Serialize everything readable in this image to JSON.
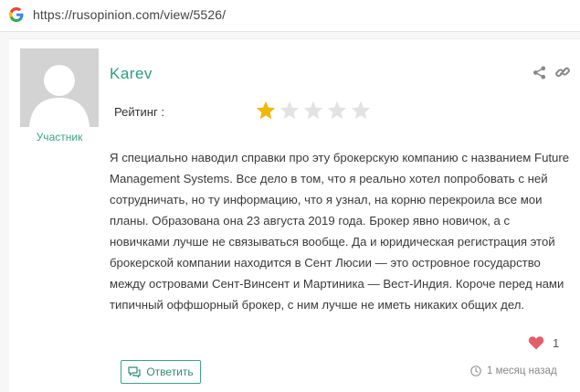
{
  "browser": {
    "url": "https://rusopinion.com/view/5526/",
    "icon": "google-g-icon"
  },
  "review": {
    "author": "Karev",
    "role": "Участник",
    "rating_label": "Рейтинг :",
    "rating": 1,
    "rating_max": 5,
    "star_filled_color": "#f2b705",
    "star_empty_color": "#e3e3e3",
    "text": "Я специально наводил справки про эту брокерскую компанию с названием Future Management Systems. Все дело в том, что я реально хотел попробовать с ней сотрудничать, но ту информацию, что я узнал, на корню перекроила все мои планы. Образована она 23 августа 2019 года. Брокер явно новичок, а с новичками лучше не связываться вообще. Да и юридическая регистрация этой брокерской компании находится в Сент Люсии — это островное государство между островами Сент-Винсент и Мартиника — Вест-Индия. Короче перед нами типичный оффшорный брокер, с ним лучше не иметь никаких общих дел.",
    "likes": "1",
    "reply_label": "Ответить",
    "time_ago": "1 месяц назад",
    "icons": {
      "share": "share-icon",
      "link": "link-icon",
      "like": "heart-icon",
      "reply": "chat-bubble-icon",
      "time": "clock-icon",
      "avatar": "user-avatar-placeholder"
    },
    "accent_color": "#29a083"
  }
}
